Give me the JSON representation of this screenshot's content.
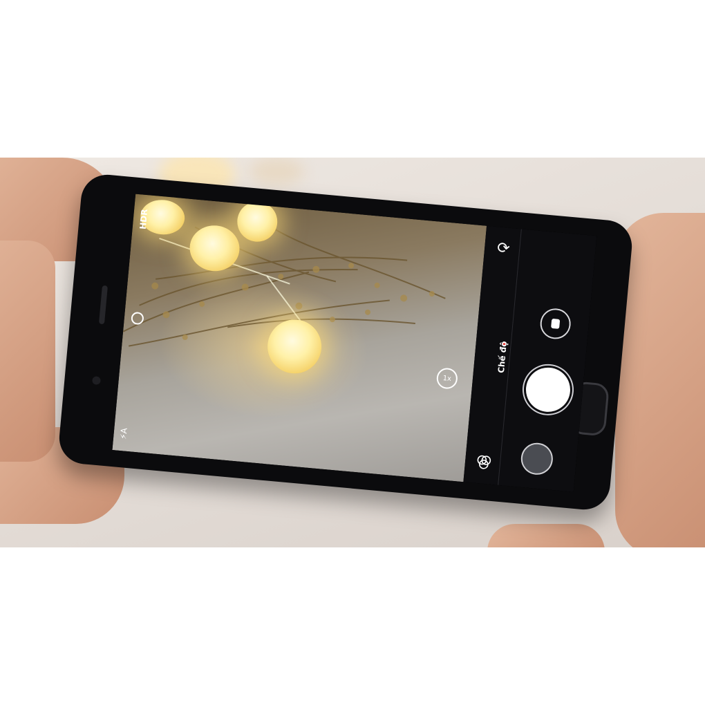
{
  "camera_ui": {
    "mode_label": "Chế độ",
    "zoom_label": "1x",
    "hdr_label": "HDR",
    "flash_label": "⚡A"
  },
  "icons": {
    "switch_camera": "switch-camera-icon",
    "filters": "filters-icon",
    "video": "video-icon",
    "timer": "timer-icon"
  },
  "colors": {
    "mode_indicator": "#e53935",
    "shutter": "#ffffff",
    "control_bar": "#0d0d10"
  }
}
